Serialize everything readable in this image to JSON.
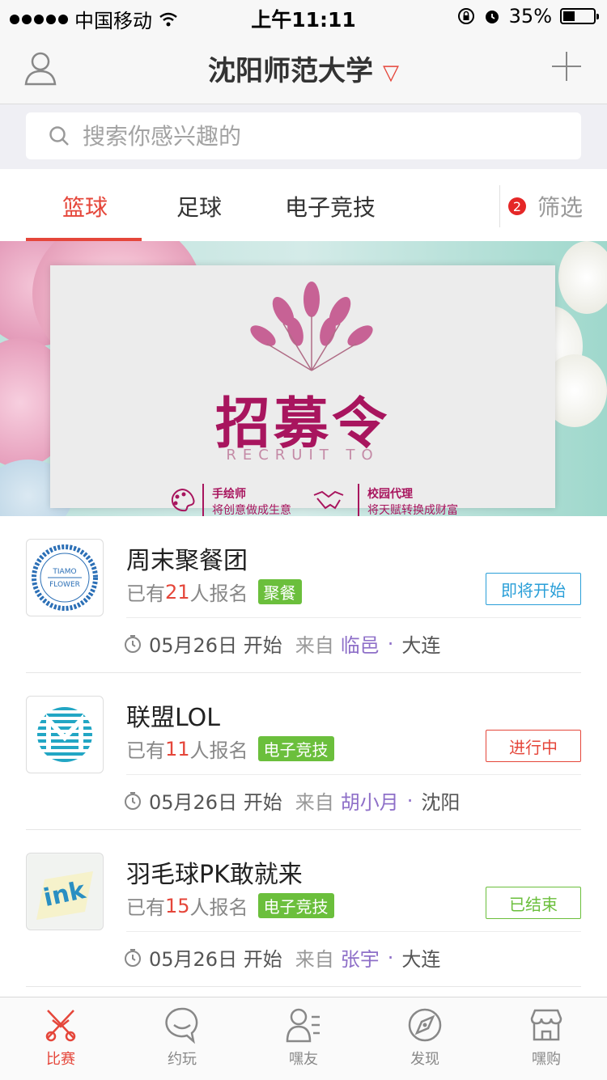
{
  "status_bar": {
    "carrier": "中国移动",
    "time": "上午11:11",
    "battery": "35%",
    "battery_level": 0.35
  },
  "nav": {
    "title": "沈阳师范大学",
    "chevron": "▽",
    "user_icon": "user-icon",
    "add_icon": "plus-icon"
  },
  "search": {
    "placeholder": "搜索你感兴趣的"
  },
  "tabs": [
    {
      "label": "篮球",
      "active": true
    },
    {
      "label": "足球",
      "active": false
    },
    {
      "label": "电子竞技",
      "active": false
    }
  ],
  "filter": {
    "badge": "2",
    "label": "筛选"
  },
  "banner": {
    "title": "招募令",
    "subtitle": "RECRUIT TO",
    "items": [
      {
        "title": "手绘师",
        "desc": "将创意做成生意"
      },
      {
        "title": "校园代理",
        "desc": "将天赋转换成财富"
      }
    ]
  },
  "events": [
    {
      "title": "周末聚餐团",
      "count_prefix": "已有",
      "count": "21",
      "count_suffix": "人报名",
      "tag": "聚餐",
      "status": "即将开始",
      "status_color": "#2a9fd8",
      "date": "05月26日 开始",
      "from_label": "来自",
      "user": "临邑",
      "dot": "·",
      "city": "大连",
      "thumb": "tiamo-flower-logo",
      "thumb_text_top": "TIAMO",
      "thumb_text_bottom": "FLOWER"
    },
    {
      "title": "联盟LOL",
      "count_prefix": "已有",
      "count": "11",
      "count_suffix": "人报名",
      "tag": "电子竞技",
      "status": "进行中",
      "status_color": "#e5463a",
      "date": "05月26日 开始",
      "from_label": "来自",
      "user": "胡小月",
      "dot": "·",
      "city": "沈阳",
      "thumb": "m-stripe-logo"
    },
    {
      "title": "羽毛球PK敢就来",
      "count_prefix": "已有",
      "count": "15",
      "count_suffix": "人报名",
      "tag": "电子竞技",
      "status": "已结束",
      "status_color": "#6bbf3c",
      "date": "05月26日 开始",
      "from_label": "来自",
      "user": "张宇",
      "dot": "·",
      "city": "大连",
      "thumb": "ink-logo",
      "thumb_text": "ink"
    }
  ],
  "tabbar": [
    {
      "label": "比赛",
      "icon": "match-icon",
      "active": true
    },
    {
      "label": "约玩",
      "icon": "chat-bubble-icon",
      "active": false
    },
    {
      "label": "嘿友",
      "icon": "friends-icon",
      "active": false
    },
    {
      "label": "发现",
      "icon": "compass-icon",
      "active": false
    },
    {
      "label": "嘿购",
      "icon": "shop-icon",
      "active": false
    }
  ],
  "colors": {
    "accent": "#e5463a",
    "tag_green": "#6bbf3c",
    "link_purple": "#8e6fc8",
    "banner_title": "#a8155e"
  }
}
